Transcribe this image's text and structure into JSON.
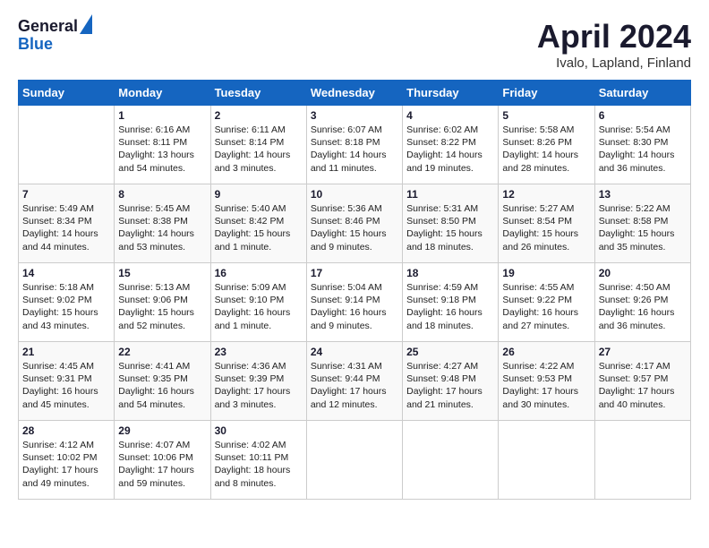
{
  "header": {
    "logo_general": "General",
    "logo_blue": "Blue",
    "month_title": "April 2024",
    "location": "Ivalo, Lapland, Finland"
  },
  "columns": [
    "Sunday",
    "Monday",
    "Tuesday",
    "Wednesday",
    "Thursday",
    "Friday",
    "Saturday"
  ],
  "weeks": [
    [
      {
        "day": "",
        "sunrise": "",
        "sunset": "",
        "daylight": ""
      },
      {
        "day": "1",
        "sunrise": "Sunrise: 6:16 AM",
        "sunset": "Sunset: 8:11 PM",
        "daylight": "Daylight: 13 hours and 54 minutes."
      },
      {
        "day": "2",
        "sunrise": "Sunrise: 6:11 AM",
        "sunset": "Sunset: 8:14 PM",
        "daylight": "Daylight: 14 hours and 3 minutes."
      },
      {
        "day": "3",
        "sunrise": "Sunrise: 6:07 AM",
        "sunset": "Sunset: 8:18 PM",
        "daylight": "Daylight: 14 hours and 11 minutes."
      },
      {
        "day": "4",
        "sunrise": "Sunrise: 6:02 AM",
        "sunset": "Sunset: 8:22 PM",
        "daylight": "Daylight: 14 hours and 19 minutes."
      },
      {
        "day": "5",
        "sunrise": "Sunrise: 5:58 AM",
        "sunset": "Sunset: 8:26 PM",
        "daylight": "Daylight: 14 hours and 28 minutes."
      },
      {
        "day": "6",
        "sunrise": "Sunrise: 5:54 AM",
        "sunset": "Sunset: 8:30 PM",
        "daylight": "Daylight: 14 hours and 36 minutes."
      }
    ],
    [
      {
        "day": "7",
        "sunrise": "Sunrise: 5:49 AM",
        "sunset": "Sunset: 8:34 PM",
        "daylight": "Daylight: 14 hours and 44 minutes."
      },
      {
        "day": "8",
        "sunrise": "Sunrise: 5:45 AM",
        "sunset": "Sunset: 8:38 PM",
        "daylight": "Daylight: 14 hours and 53 minutes."
      },
      {
        "day": "9",
        "sunrise": "Sunrise: 5:40 AM",
        "sunset": "Sunset: 8:42 PM",
        "daylight": "Daylight: 15 hours and 1 minute."
      },
      {
        "day": "10",
        "sunrise": "Sunrise: 5:36 AM",
        "sunset": "Sunset: 8:46 PM",
        "daylight": "Daylight: 15 hours and 9 minutes."
      },
      {
        "day": "11",
        "sunrise": "Sunrise: 5:31 AM",
        "sunset": "Sunset: 8:50 PM",
        "daylight": "Daylight: 15 hours and 18 minutes."
      },
      {
        "day": "12",
        "sunrise": "Sunrise: 5:27 AM",
        "sunset": "Sunset: 8:54 PM",
        "daylight": "Daylight: 15 hours and 26 minutes."
      },
      {
        "day": "13",
        "sunrise": "Sunrise: 5:22 AM",
        "sunset": "Sunset: 8:58 PM",
        "daylight": "Daylight: 15 hours and 35 minutes."
      }
    ],
    [
      {
        "day": "14",
        "sunrise": "Sunrise: 5:18 AM",
        "sunset": "Sunset: 9:02 PM",
        "daylight": "Daylight: 15 hours and 43 minutes."
      },
      {
        "day": "15",
        "sunrise": "Sunrise: 5:13 AM",
        "sunset": "Sunset: 9:06 PM",
        "daylight": "Daylight: 15 hours and 52 minutes."
      },
      {
        "day": "16",
        "sunrise": "Sunrise: 5:09 AM",
        "sunset": "Sunset: 9:10 PM",
        "daylight": "Daylight: 16 hours and 1 minute."
      },
      {
        "day": "17",
        "sunrise": "Sunrise: 5:04 AM",
        "sunset": "Sunset: 9:14 PM",
        "daylight": "Daylight: 16 hours and 9 minutes."
      },
      {
        "day": "18",
        "sunrise": "Sunrise: 4:59 AM",
        "sunset": "Sunset: 9:18 PM",
        "daylight": "Daylight: 16 hours and 18 minutes."
      },
      {
        "day": "19",
        "sunrise": "Sunrise: 4:55 AM",
        "sunset": "Sunset: 9:22 PM",
        "daylight": "Daylight: 16 hours and 27 minutes."
      },
      {
        "day": "20",
        "sunrise": "Sunrise: 4:50 AM",
        "sunset": "Sunset: 9:26 PM",
        "daylight": "Daylight: 16 hours and 36 minutes."
      }
    ],
    [
      {
        "day": "21",
        "sunrise": "Sunrise: 4:45 AM",
        "sunset": "Sunset: 9:31 PM",
        "daylight": "Daylight: 16 hours and 45 minutes."
      },
      {
        "day": "22",
        "sunrise": "Sunrise: 4:41 AM",
        "sunset": "Sunset: 9:35 PM",
        "daylight": "Daylight: 16 hours and 54 minutes."
      },
      {
        "day": "23",
        "sunrise": "Sunrise: 4:36 AM",
        "sunset": "Sunset: 9:39 PM",
        "daylight": "Daylight: 17 hours and 3 minutes."
      },
      {
        "day": "24",
        "sunrise": "Sunrise: 4:31 AM",
        "sunset": "Sunset: 9:44 PM",
        "daylight": "Daylight: 17 hours and 12 minutes."
      },
      {
        "day": "25",
        "sunrise": "Sunrise: 4:27 AM",
        "sunset": "Sunset: 9:48 PM",
        "daylight": "Daylight: 17 hours and 21 minutes."
      },
      {
        "day": "26",
        "sunrise": "Sunrise: 4:22 AM",
        "sunset": "Sunset: 9:53 PM",
        "daylight": "Daylight: 17 hours and 30 minutes."
      },
      {
        "day": "27",
        "sunrise": "Sunrise: 4:17 AM",
        "sunset": "Sunset: 9:57 PM",
        "daylight": "Daylight: 17 hours and 40 minutes."
      }
    ],
    [
      {
        "day": "28",
        "sunrise": "Sunrise: 4:12 AM",
        "sunset": "Sunset: 10:02 PM",
        "daylight": "Daylight: 17 hours and 49 minutes."
      },
      {
        "day": "29",
        "sunrise": "Sunrise: 4:07 AM",
        "sunset": "Sunset: 10:06 PM",
        "daylight": "Daylight: 17 hours and 59 minutes."
      },
      {
        "day": "30",
        "sunrise": "Sunrise: 4:02 AM",
        "sunset": "Sunset: 10:11 PM",
        "daylight": "Daylight: 18 hours and 8 minutes."
      },
      {
        "day": "",
        "sunrise": "",
        "sunset": "",
        "daylight": ""
      },
      {
        "day": "",
        "sunrise": "",
        "sunset": "",
        "daylight": ""
      },
      {
        "day": "",
        "sunrise": "",
        "sunset": "",
        "daylight": ""
      },
      {
        "day": "",
        "sunrise": "",
        "sunset": "",
        "daylight": ""
      }
    ]
  ]
}
